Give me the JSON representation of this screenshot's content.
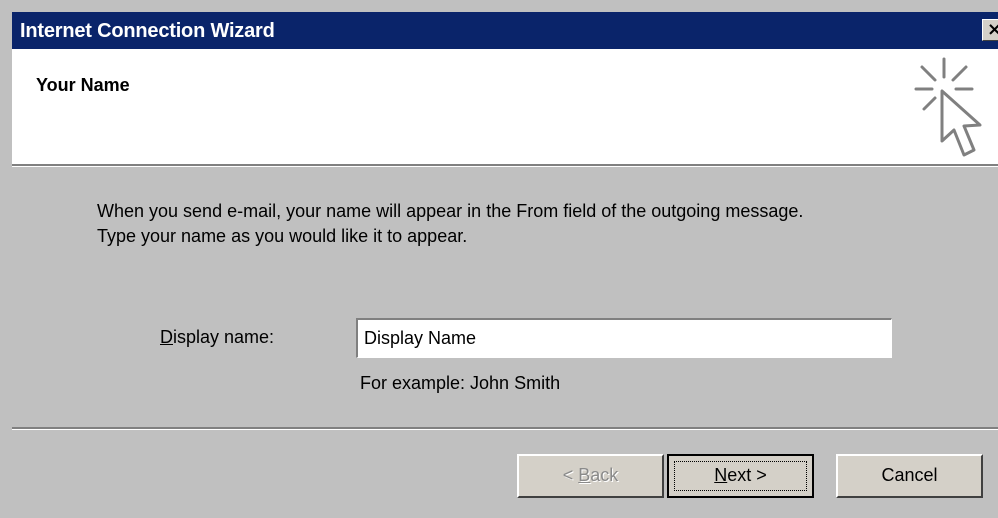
{
  "window": {
    "title": "Internet Connection Wizard",
    "close_glyph": "×"
  },
  "header": {
    "title": "Your Name",
    "icon": "wizard-cursor-sparkle-icon"
  },
  "main": {
    "description_line1": "When you send e-mail, your name will appear in the From field of the outgoing message.",
    "description_line2": "Type your name as you would like it to appear.",
    "display_name_label_mnemonic": "D",
    "display_name_label_rest": "isplay name:",
    "display_name_value": "Display Name",
    "example_text": "For example: John Smith"
  },
  "buttons": {
    "back_prefix": "< ",
    "back_mnemonic": "B",
    "back_rest": "ack",
    "back_enabled": false,
    "next_mnemonic": "N",
    "next_rest": "ext >",
    "cancel": "Cancel"
  },
  "colors": {
    "title_bar": "#0a246a",
    "dialog_face": "#c0c0c0",
    "header_bg": "#ffffff"
  }
}
